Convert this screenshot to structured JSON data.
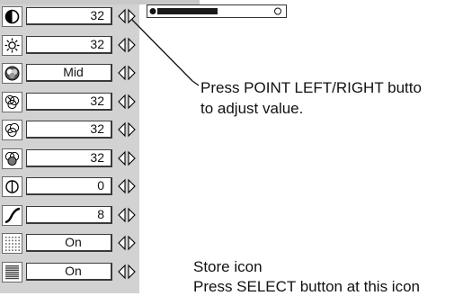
{
  "adjust_menu": {
    "rows": [
      {
        "icon": "contrast-icon",
        "value": "32"
      },
      {
        "icon": "brightness-icon",
        "value": "32"
      },
      {
        "icon": "color-temperature-icon",
        "value": "Mid"
      },
      {
        "icon": "red-balance-icon",
        "value": "32"
      },
      {
        "icon": "green-balance-icon",
        "value": "32"
      },
      {
        "icon": "blue-balance-icon",
        "value": "32"
      },
      {
        "icon": "sharpness-icon",
        "value": "0"
      },
      {
        "icon": "gamma-icon",
        "value": "8"
      },
      {
        "icon": "noise-reduction-icon",
        "value": "On"
      },
      {
        "icon": "progressive-icon",
        "value": "On"
      }
    ]
  },
  "slider": {
    "level_fraction": 0.5
  },
  "callouts": {
    "adjust_line1": "Press POINT LEFT/RIGHT butto",
    "adjust_line2": "to adjust value.",
    "store_title": "Store icon",
    "store_line2": "Press SELECT button at this icon"
  },
  "colors": {
    "panel": "#d2d2d2",
    "slider_fill": "#1a1a1a"
  }
}
